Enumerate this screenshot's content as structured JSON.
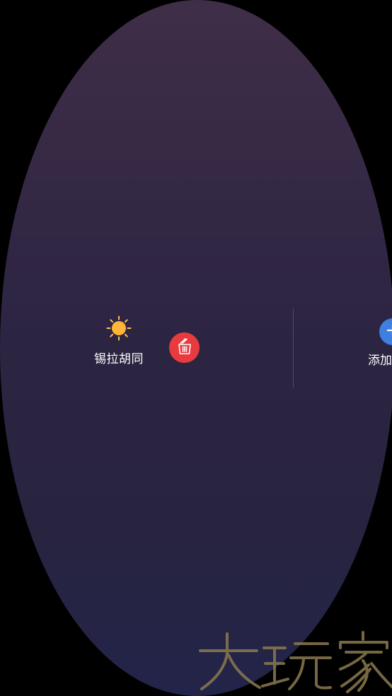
{
  "city": {
    "name": "锡拉胡同",
    "weather_icon": "sun-icon"
  },
  "delete": {
    "icon": "trash-icon"
  },
  "add": {
    "label": "添加",
    "icon": "plus-icon"
  },
  "watermark": {
    "text": "大玩家"
  },
  "colors": {
    "background": "#000000",
    "oval_top": "#3f2e47",
    "oval_bottom": "#23244a",
    "delete": "#e93a3e",
    "add": "#3e7fe0",
    "sun": "#ffb53a"
  }
}
